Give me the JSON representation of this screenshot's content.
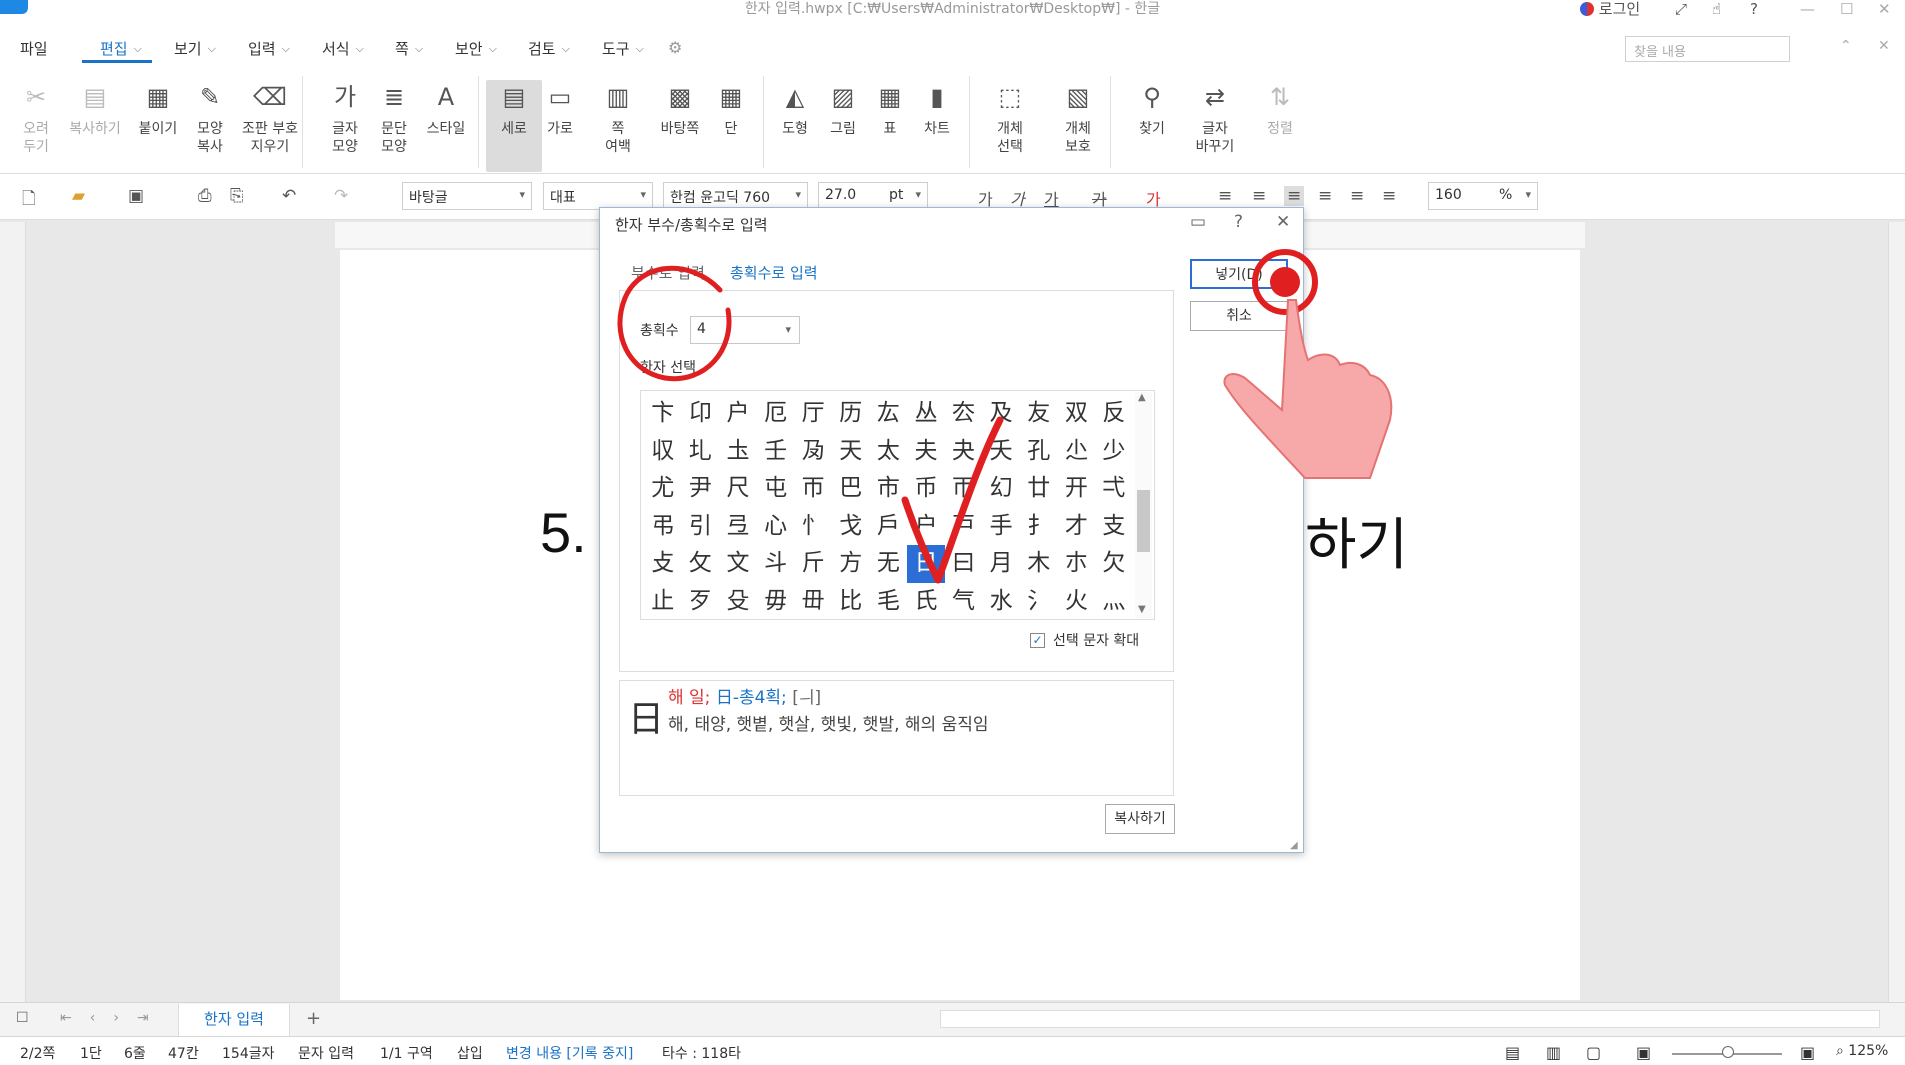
{
  "window": {
    "title": "한자 입력.hwpx [C:₩Users₩Administrator₩Desktop₩] - 한글",
    "login": "로그인"
  },
  "menu": {
    "items": [
      "파일",
      "편집",
      "보기",
      "입력",
      "서식",
      "쪽",
      "보안",
      "검토",
      "도구"
    ],
    "active": "편집",
    "search_placeholder": "찾을 내용"
  },
  "ribbon": {
    "buttons": [
      {
        "l1": "오려",
        "l2": "두기",
        "icon": "scissors-icon"
      },
      {
        "l1": "복사하기",
        "l2": "",
        "icon": "copy-icon"
      },
      {
        "l1": "붙이기",
        "l2": "",
        "icon": "paste-icon"
      },
      {
        "l1": "모양",
        "l2": "복사",
        "icon": "format-painter-icon"
      },
      {
        "l1": "조판 부호",
        "l2": "지우기",
        "icon": "clear-codes-icon"
      },
      {
        "l1": "글자",
        "l2": "모양",
        "icon": "char-shape-icon"
      },
      {
        "l1": "문단",
        "l2": "모양",
        "icon": "para-shape-icon"
      },
      {
        "l1": "스타일",
        "l2": "",
        "icon": "style-icon"
      },
      {
        "l1": "세로",
        "l2": "",
        "icon": "portrait-icon"
      },
      {
        "l1": "가로",
        "l2": "",
        "icon": "landscape-icon"
      },
      {
        "l1": "쪽",
        "l2": "여백",
        "icon": "margin-icon"
      },
      {
        "l1": "바탕쪽",
        "l2": "",
        "icon": "master-page-icon"
      },
      {
        "l1": "단",
        "l2": "",
        "icon": "columns-icon"
      },
      {
        "l1": "도형",
        "l2": "",
        "icon": "shape-icon"
      },
      {
        "l1": "그림",
        "l2": "",
        "icon": "picture-icon"
      },
      {
        "l1": "표",
        "l2": "",
        "icon": "table-icon"
      },
      {
        "l1": "차트",
        "l2": "",
        "icon": "chart-icon"
      },
      {
        "l1": "개체",
        "l2": "선택",
        "icon": "object-select-icon"
      },
      {
        "l1": "개체",
        "l2": "보호",
        "icon": "object-protect-icon"
      },
      {
        "l1": "찾기",
        "l2": "",
        "icon": "binoculars-icon"
      },
      {
        "l1": "글자",
        "l2": "바꾸기",
        "icon": "char-replace-icon"
      },
      {
        "l1": "정렬",
        "l2": "",
        "icon": "sort-icon"
      }
    ]
  },
  "format": {
    "style": "바탕글",
    "lang": "대표",
    "font": "한컴 윤고딕 760",
    "size": "27.0",
    "unit": "pt",
    "zoom": "160",
    "zoom_unit": "%"
  },
  "document": {
    "left_text": "5.",
    "right_text": "하기"
  },
  "tabs": {
    "doc_tab": "한자 입력",
    "add": "+"
  },
  "status": {
    "page": "2/2쪽",
    "column": "1단",
    "line": "6줄",
    "col": "47칸",
    "chars": "154글자",
    "mode": "문자 입력",
    "section": "1/1 구역",
    "insert": "삽입",
    "track": "변경 내용 [기록 중지]",
    "typing": "타수 : 118타",
    "zoom": "125%"
  },
  "dialog": {
    "title": "한자 부수/총획수로 입력",
    "tab_radical": "부수로 입력",
    "tab_stroke": "총획수로 입력",
    "stroke_label": "총획수",
    "stroke_value": "4",
    "select_label": "한자 선택",
    "chars": [
      "卞",
      "卬",
      "户",
      "厄",
      "厅",
      "历",
      "厷",
      "丛",
      "厺",
      "及",
      "友",
      "双",
      "反",
      "収",
      "圠",
      "圡",
      "壬",
      "夃",
      "天",
      "太",
      "夫",
      "夬",
      "夭",
      "孔",
      "尐",
      "少",
      "尤",
      "尹",
      "尺",
      "屯",
      "帀",
      "巴",
      "市",
      "币",
      "帀",
      "幻",
      "廿",
      "开",
      "弌",
      "弔",
      "引",
      "弖",
      "心",
      "忄",
      "戈",
      "戶",
      "户",
      "戸",
      "手",
      "扌",
      "才",
      "支",
      "攴",
      "攵",
      "文",
      "斗",
      "斤",
      "方",
      "无",
      "日",
      "曰",
      "月",
      "木",
      "朩",
      "欠",
      "止",
      "歹",
      "殳",
      "毋",
      "毌",
      "比",
      "毛",
      "氏",
      "气",
      "水",
      "氵",
      "火",
      "灬"
    ],
    "selected_index": 59,
    "enlarge_label": "선택 문자 확대",
    "enlarge_checked": true,
    "info_char": "日",
    "info_reading": "해 일;",
    "info_radical": "日-총4획;",
    "info_sound": "[ㅢ]",
    "info_meaning": "해, 태양, 햇볕, 햇살, 햇빛, 햇발, 해의 움직임",
    "btn_insert": "넣기(D)",
    "btn_cancel": "취소",
    "btn_copy": "복사하기"
  }
}
